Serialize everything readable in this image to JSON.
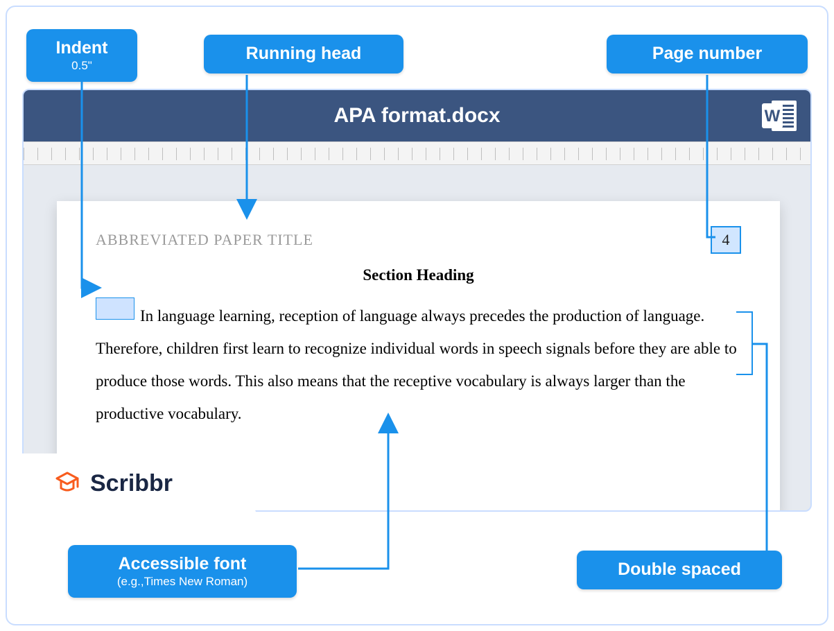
{
  "callouts": {
    "indent": {
      "title": "Indent",
      "sub": "0.5\""
    },
    "running_head": {
      "title": "Running head"
    },
    "page_number": {
      "title": "Page number"
    },
    "accessible_font": {
      "title": "Accessible font",
      "sub": "(e.g.,Times New Roman)"
    },
    "double_spaced": {
      "title": "Double spaced"
    }
  },
  "window": {
    "title": "APA format.docx"
  },
  "document": {
    "running_head": "ABBREVIATED PAPER TITLE",
    "page_number": "4",
    "section_heading": "Section Heading",
    "body": "In language learning, reception of language always precedes the production of language. Therefore, children first learn to recognize individual words in speech signals before they are able to produce those words. This also means that the receptive vocabulary is always larger than the productive vocabulary."
  },
  "brand": {
    "name": "Scribbr"
  }
}
